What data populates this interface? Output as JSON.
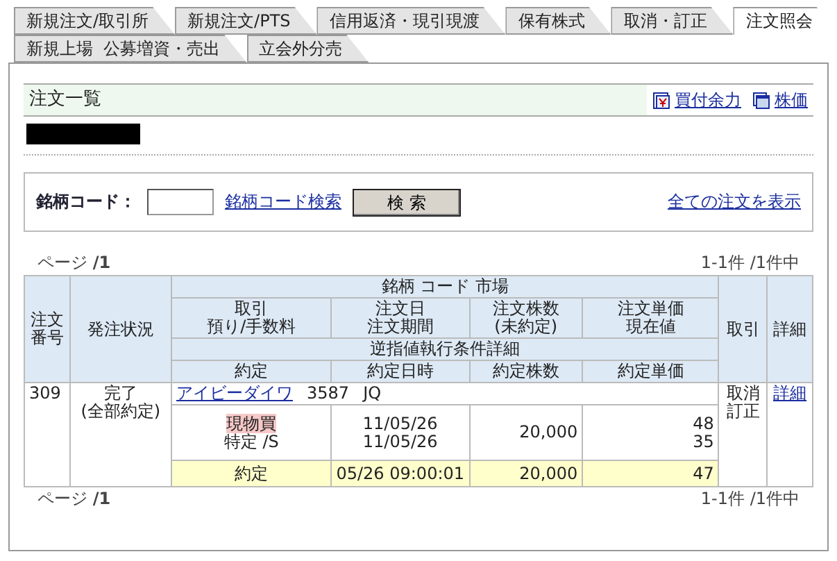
{
  "tabs": [
    [
      {
        "label": "新規注文/取引所",
        "selected": false
      },
      {
        "label": "新規注文/PTS",
        "selected": false
      },
      {
        "label": "信用返済・現引現渡",
        "selected": false
      },
      {
        "label": "保有株式",
        "selected": false
      },
      {
        "label": "取消・訂正",
        "selected": false
      },
      {
        "label": "注文照会",
        "selected": true
      }
    ],
    [
      {
        "label": "新規上場  公募増資・売出",
        "selected": false
      },
      {
        "label": "立会外分売",
        "selected": false
      }
    ]
  ],
  "header": {
    "title": "注文一覧",
    "links": [
      {
        "label": "買付余力",
        "kind": "yen"
      },
      {
        "label": "株価",
        "kind": "window"
      }
    ]
  },
  "search": {
    "label": "銘柄コード：",
    "link": "銘柄コード検索",
    "button": "検 索",
    "show_all": "全ての注文を表示"
  },
  "pager_top": {
    "page": "ページ **/1**",
    "count": "1-1件 /1件中"
  },
  "table": {
    "head": {
      "number": [
        "注文",
        "番号"
      ],
      "status": "発注状況",
      "stock": "銘柄 コード 市場",
      "trade": [
        "取引",
        "預り/手数料"
      ],
      "date": [
        "注文日",
        "注文期間"
      ],
      "quantity": [
        "注文株数",
        "(未約定)"
      ],
      "price": [
        "注文単価",
        "現在値"
      ],
      "action": "取引",
      "detail": "詳細",
      "condition": "逆指値執行条件詳細",
      "exec": "約定",
      "exec_time": "約定日時",
      "exec_quantity": "約定株数",
      "exec_price": "約定単価"
    },
    "orders": [
      {
        "number": "309",
        "status": [
          "完了",
          "(全部約定)"
        ],
        "name": "アイビーダイワ",
        "code": "3587",
        "market": "JQ",
        "trade": "現物買",
        "account": "特定 /S",
        "order_date": "11/05/26",
        "period": "11/05/26",
        "quantity": "20,000",
        "price": "48",
        "current": "35",
        "actions": [
          "取消",
          "訂正"
        ],
        "detail": "詳細",
        "exec": "約定",
        "exec_time": "05/26 09:00:01",
        "exec_quantity": "20,000",
        "exec_price": "47"
      }
    ]
  },
  "pager_bottom": {
    "page": "ページ **/1**",
    "count": "1-1件 /1件中"
  }
}
